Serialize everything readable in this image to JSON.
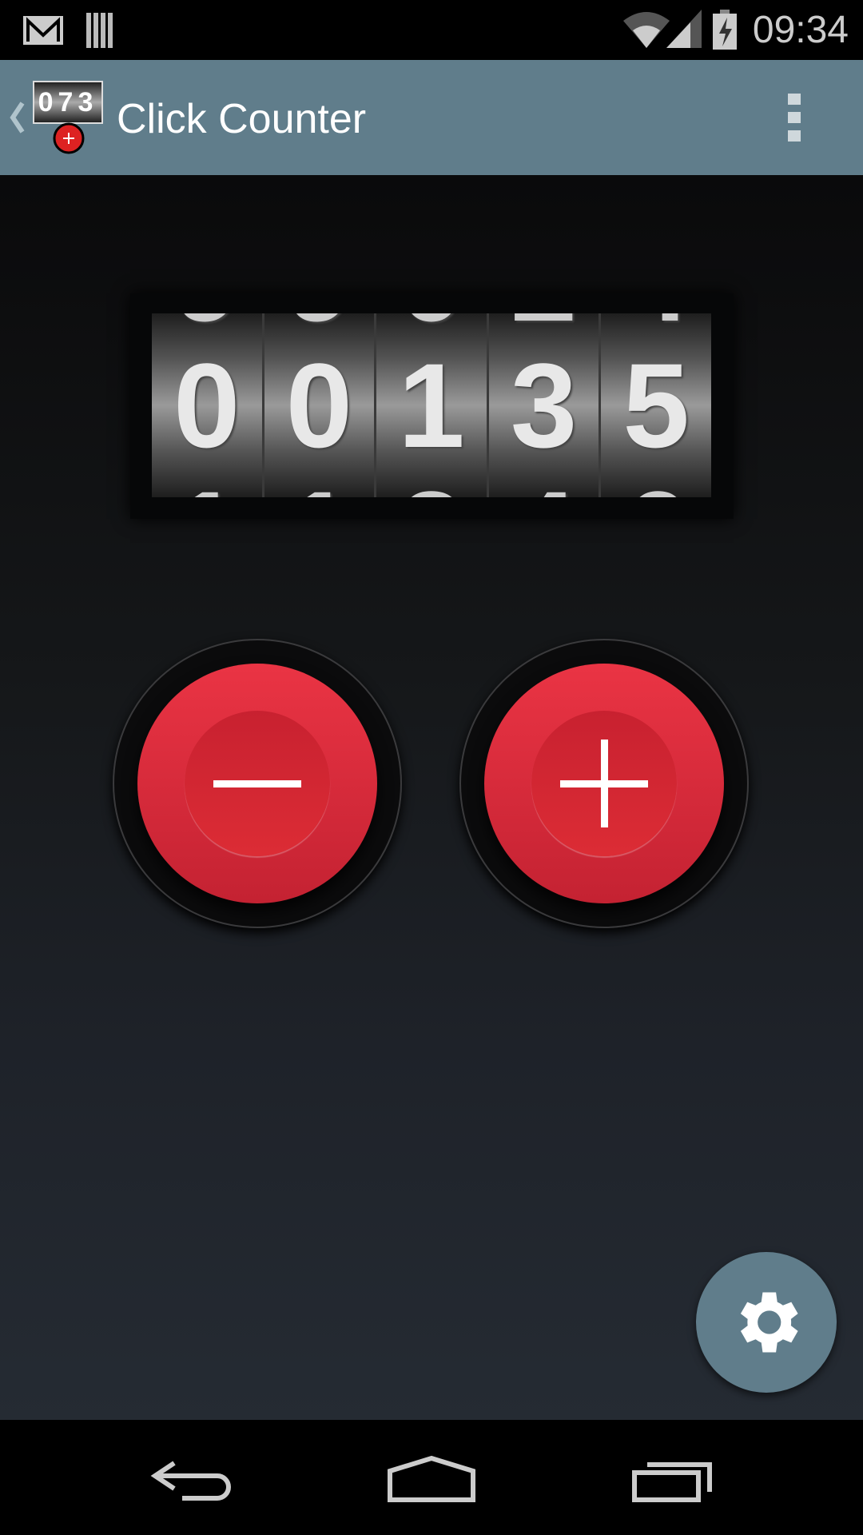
{
  "status_bar": {
    "time": "09:34",
    "icons": [
      "gmail-icon",
      "barcode-icon",
      "wifi-icon",
      "signal-icon",
      "battery-charging-icon"
    ]
  },
  "app_bar": {
    "title": "Click Counter",
    "icon_digits": "073",
    "menu_icon": "overflow-menu-icon"
  },
  "counter": {
    "value": "00135"
  },
  "buttons": {
    "decrement": "minus-icon",
    "increment": "plus-icon"
  },
  "fab": {
    "icon": "gear-icon"
  },
  "nav_bar": {
    "icons": [
      "back-icon",
      "home-icon",
      "recents-icon"
    ]
  },
  "colors": {
    "app_bar": "#607d8b",
    "button_red": "#e0303e",
    "fab": "#607d8b"
  }
}
